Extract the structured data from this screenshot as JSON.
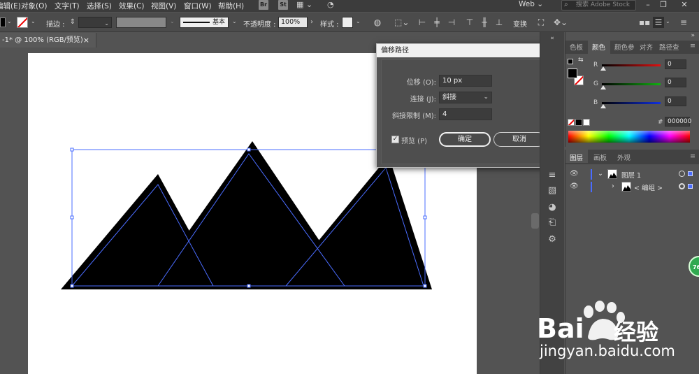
{
  "menubar": {
    "items": [
      "编辑(E)",
      "对象(O)",
      "文字(T)",
      "选择(S)",
      "效果(C)",
      "视图(V)",
      "窗口(W)",
      "帮助(H)"
    ],
    "bridge_badge": "Br",
    "stock_badge": "St",
    "workspace": "Web",
    "search_placeholder": "搜索 Adobe Stock"
  },
  "controlbar": {
    "stroke_label": "描边 :",
    "stroke_style": "基本",
    "opacity_label": "不透明度 :",
    "opacity_value": "100%",
    "style_label": "样式 :",
    "transform_label": "变换"
  },
  "document_tab": {
    "title": "-1* @ 100% (RGB/预览)",
    "close_glyph": "×"
  },
  "offset_path_dialog": {
    "title": "偏移路径",
    "offset_label": "位移 (O):",
    "offset_value": "10 px",
    "joins_label": "连接 (J):",
    "joins_value": "斜接",
    "miter_label": "斜接限制 (M):",
    "miter_value": "4",
    "preview_label": "预览 (P)",
    "preview_checked": true,
    "ok_label": "确定",
    "cancel_label": "取消"
  },
  "color_panel": {
    "tabs": [
      "色板",
      "颜色",
      "颜色参",
      "对齐",
      "路径查"
    ],
    "active_tab": 1,
    "channels": [
      {
        "label": "R",
        "value": "0",
        "color": "#e01010"
      },
      {
        "label": "G",
        "value": "0",
        "color": "#10b010"
      },
      {
        "label": "B",
        "value": "0",
        "color": "#1030e0"
      }
    ],
    "hex_symbol": "#",
    "hex_value": "000000"
  },
  "layers_panel": {
    "tabs": [
      "图层",
      "画板",
      "外观"
    ],
    "active_tab": 0,
    "layers": [
      {
        "name": "图层 1",
        "expanded": true
      },
      {
        "name": "< 编组 >",
        "expanded": false
      }
    ]
  },
  "floating_badge": "76",
  "watermark": {
    "brand_latin": "Bai",
    "brand_cn": "经验",
    "url": "jingyan.baidu.com"
  },
  "colors": {
    "ui_dark": "#535353",
    "artboard": "#ffffff",
    "selection": "#4a6cff",
    "shape_fill": "#000000"
  }
}
